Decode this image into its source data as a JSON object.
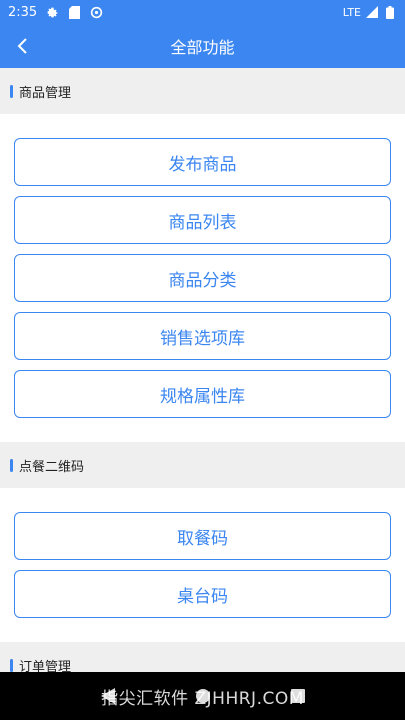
{
  "status_bar": {
    "time": "2:35",
    "network": "LTE"
  },
  "header": {
    "title": "全部功能"
  },
  "sections": [
    {
      "title": "商品管理",
      "items": [
        "发布商品",
        "商品列表",
        "商品分类",
        "销售选项库",
        "规格属性库"
      ]
    },
    {
      "title": "点餐二维码",
      "items": [
        "取餐码",
        "桌台码"
      ]
    },
    {
      "title": "订单管理",
      "items": []
    }
  ],
  "watermark": "指尖汇软件 ZJHHRJ.COM",
  "colors": {
    "primary": "#3b86f0",
    "section_bg": "#efefef"
  }
}
